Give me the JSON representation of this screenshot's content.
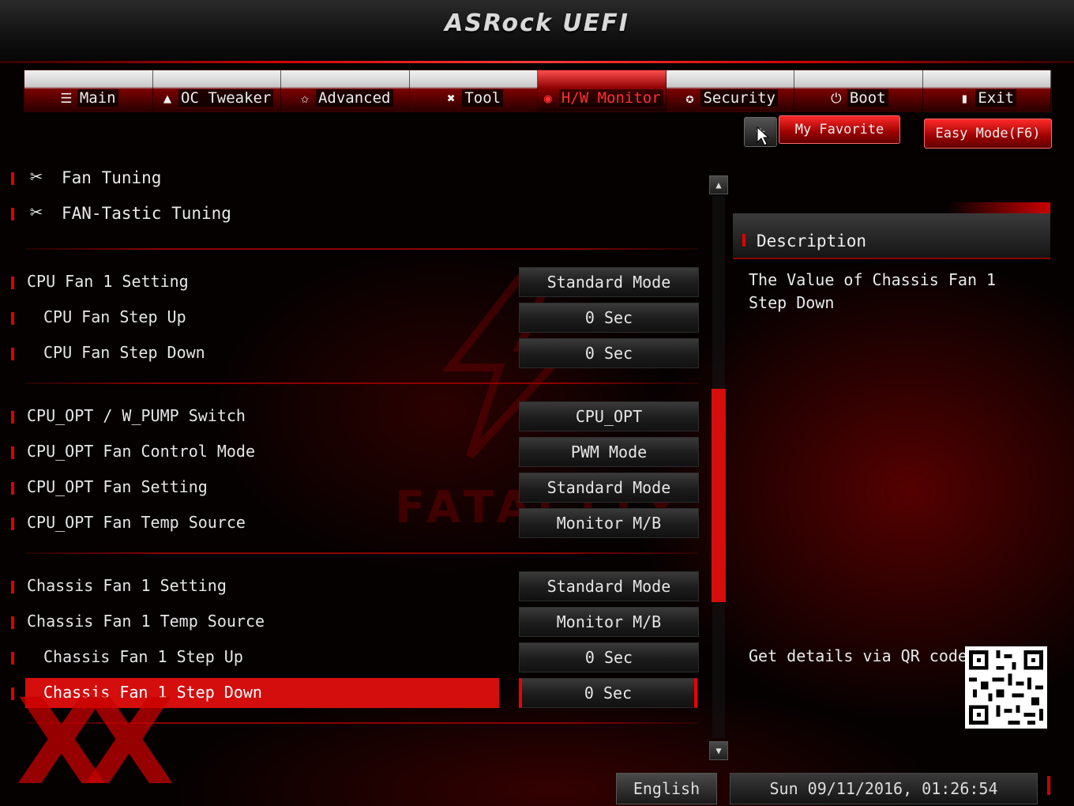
{
  "header": {
    "brand": "ASRock UEFI"
  },
  "tabs": [
    {
      "label": "Main",
      "icon": "list-icon",
      "glyph": "☰",
      "active": false
    },
    {
      "label": "OC Tweaker",
      "icon": "rocket-icon",
      "glyph": "▲",
      "active": false
    },
    {
      "label": "Advanced",
      "icon": "star-icon",
      "glyph": "✩",
      "active": false
    },
    {
      "label": "Tool",
      "icon": "tools-icon",
      "glyph": "✖",
      "active": false
    },
    {
      "label": "H/W Monitor",
      "icon": "monitor-icon",
      "glyph": "◉",
      "active": true
    },
    {
      "label": "Security",
      "icon": "shield-icon",
      "glyph": "✪",
      "active": false
    },
    {
      "label": "Boot",
      "icon": "power-icon",
      "glyph": "⏻",
      "active": false
    },
    {
      "label": "Exit",
      "icon": "exit-icon",
      "glyph": "▮",
      "active": false
    }
  ],
  "favorites": {
    "label": "My Favorite",
    "easy_mode": "Easy Mode(F6)"
  },
  "menu": [
    {
      "label": "Fan Tuning"
    },
    {
      "label": "FAN-Tastic Tuning"
    }
  ],
  "settings": [
    {
      "label": "CPU Fan 1 Setting",
      "value": "Standard Mode"
    },
    {
      "label": "CPU Fan Step Up",
      "value": "0 Sec"
    },
    {
      "label": "CPU Fan Step Down",
      "value": "0 Sec"
    },
    {
      "label": "CPU_OPT / W_PUMP Switch",
      "value": "CPU_OPT"
    },
    {
      "label": "CPU_OPT Fan Control Mode",
      "value": "PWM Mode"
    },
    {
      "label": "CPU_OPT Fan Setting",
      "value": "Standard Mode"
    },
    {
      "label": "CPU_OPT Fan Temp Source",
      "value": "Monitor M/B"
    },
    {
      "label": "Chassis Fan 1 Setting",
      "value": "Standard Mode"
    },
    {
      "label": "Chassis Fan 1 Temp Source",
      "value": "Monitor M/B"
    },
    {
      "label": "Chassis Fan 1 Step Up",
      "value": "0 Sec"
    },
    {
      "label": "Chassis Fan 1 Step Down",
      "value": "0 Sec"
    }
  ],
  "description": {
    "title": "Description",
    "text": "The Value of Chassis Fan 1 Step Down",
    "qr_label": "Get details via QR code"
  },
  "footer": {
    "language": "English",
    "datetime": "Sun 09/11/2016, 01:26:54"
  },
  "watermark": "XX",
  "background_logo": "FATAL1TY",
  "colors": {
    "accent": "#d40d0d",
    "background": "#050101",
    "text": "#e6e6e6"
  }
}
